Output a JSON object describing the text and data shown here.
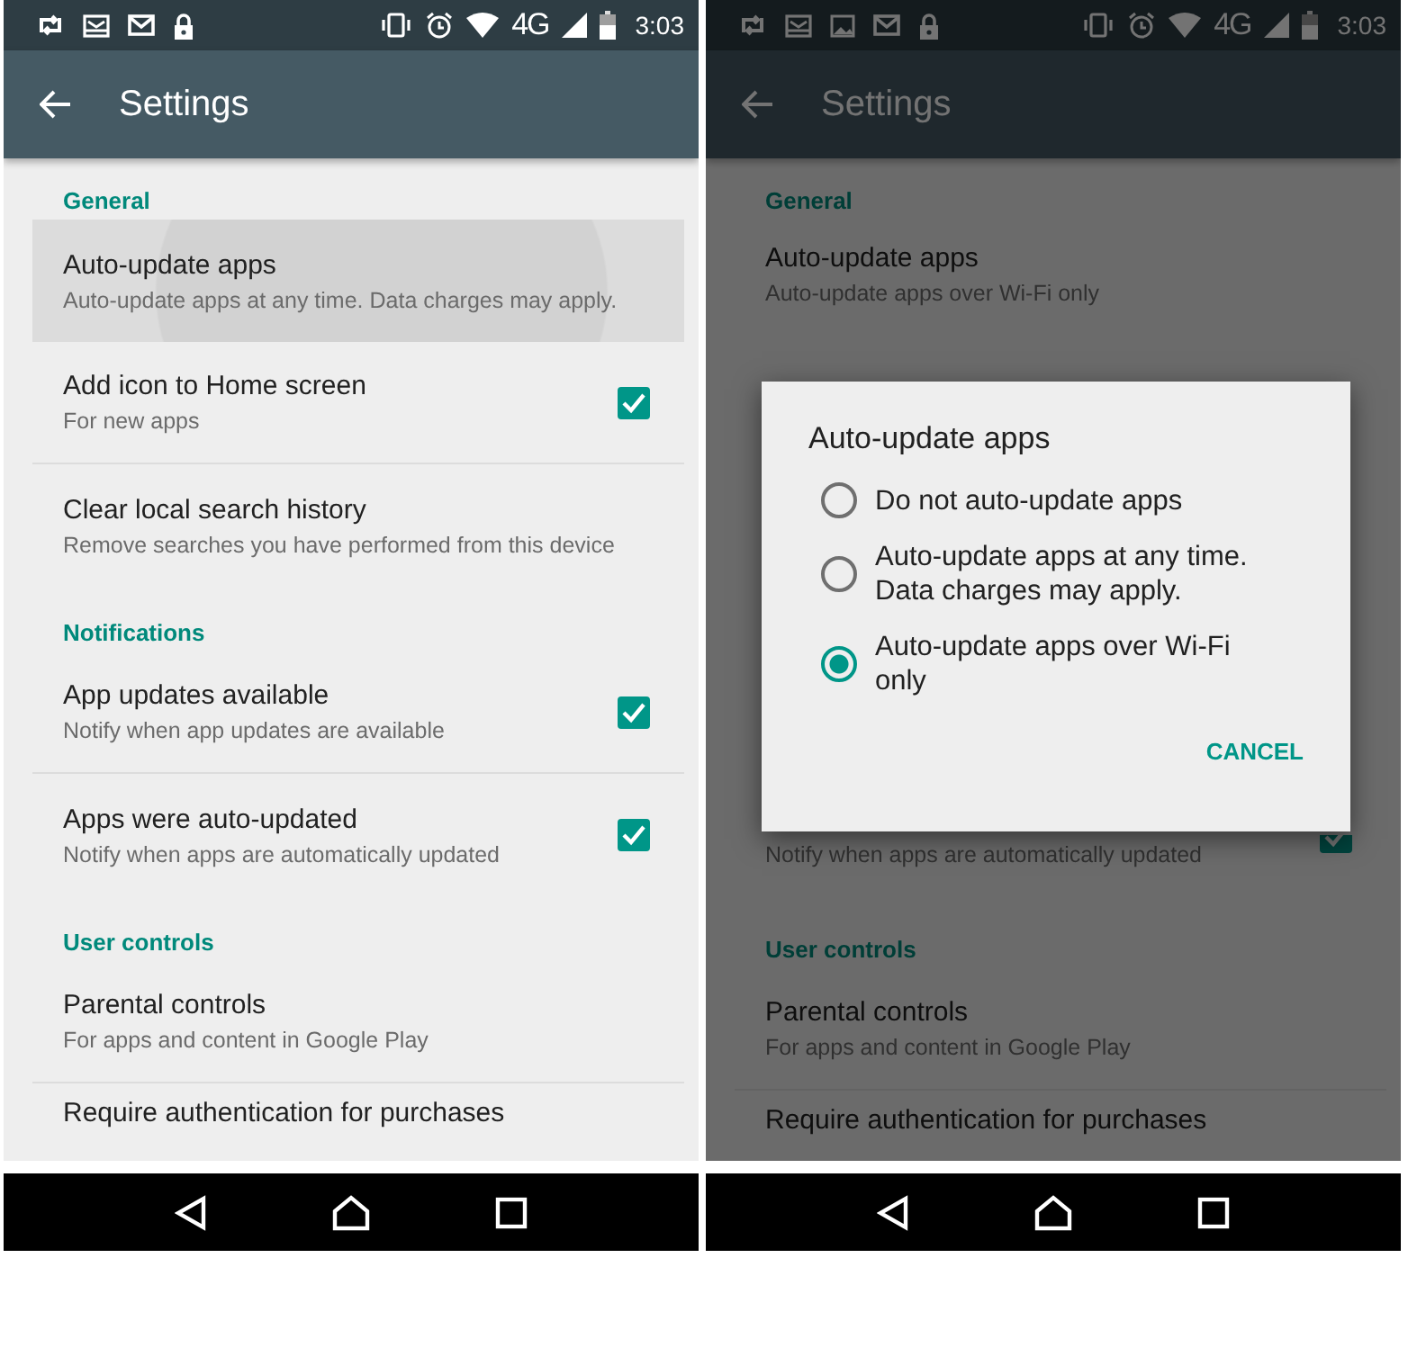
{
  "phones": [
    {
      "dimmed": false,
      "status_bar": {
        "notifications": [
          {
            "kind": "sync"
          },
          {
            "kind": "inbox"
          },
          {
            "kind": "mail"
          },
          {
            "kind": "lock"
          }
        ],
        "network": "4G",
        "time": "3:03"
      },
      "toolbar": {
        "title": "Settings"
      },
      "sections": [
        {
          "header": "General",
          "items": [
            {
              "title": "Auto-update apps",
              "subtitle": "Auto-update apps at any time. Data charges may apply.",
              "pressed": true
            },
            {
              "title": "Add icon to Home screen",
              "subtitle": "For new apps",
              "checked": true,
              "pressed": false
            },
            {
              "title": "Clear local search history",
              "subtitle": "Remove searches you have performed from this device",
              "pressed": false
            }
          ]
        },
        {
          "header": "Notifications",
          "items": [
            {
              "title": "App updates available",
              "subtitle": "Notify when app updates are available",
              "checked": true,
              "pressed": false
            },
            {
              "title": "Apps were auto-updated",
              "subtitle": "Notify when apps are automatically updated",
              "checked": true,
              "pressed": false
            }
          ]
        },
        {
          "header": "User controls",
          "items": [
            {
              "title": "Parental controls",
              "subtitle": "For apps and content in Google Play",
              "pressed": false
            },
            {
              "title": "Require authentication for purchases",
              "pressed": false
            }
          ]
        }
      ]
    },
    {
      "dimmed": true,
      "status_bar": {
        "notifications": [
          {
            "kind": "sync"
          },
          {
            "kind": "inbox"
          },
          {
            "kind": "image"
          },
          {
            "kind": "mail"
          },
          {
            "kind": "lock"
          }
        ],
        "network": "4G",
        "time": "3:03"
      },
      "toolbar": {
        "title": "Settings"
      },
      "sections": [
        {
          "header": "General",
          "items": [
            {
              "title": "Auto-update apps",
              "subtitle": "Auto-update apps over Wi-Fi only",
              "pressed": false
            }
          ]
        },
        {
          "items": [
            {
              "subtitle": "Notify when apps are automatically updated",
              "checked": true,
              "pressed": false
            }
          ]
        },
        {
          "header": "User controls",
          "items": [
            {
              "title": "Parental controls",
              "subtitle": "For apps and content in Google Play",
              "pressed": false
            },
            {
              "title": "Require authentication for purchases",
              "pressed": false
            }
          ]
        }
      ],
      "dialog": {
        "title": "Auto-update apps",
        "options": [
          {
            "label": "Do not auto-update apps",
            "selected": false
          },
          {
            "label": "Auto-update apps at any time. Data charges may apply.",
            "selected": false
          },
          {
            "label": "Auto-update apps over Wi-Fi only",
            "selected": true
          }
        ],
        "button": "CANCEL"
      }
    }
  ]
}
